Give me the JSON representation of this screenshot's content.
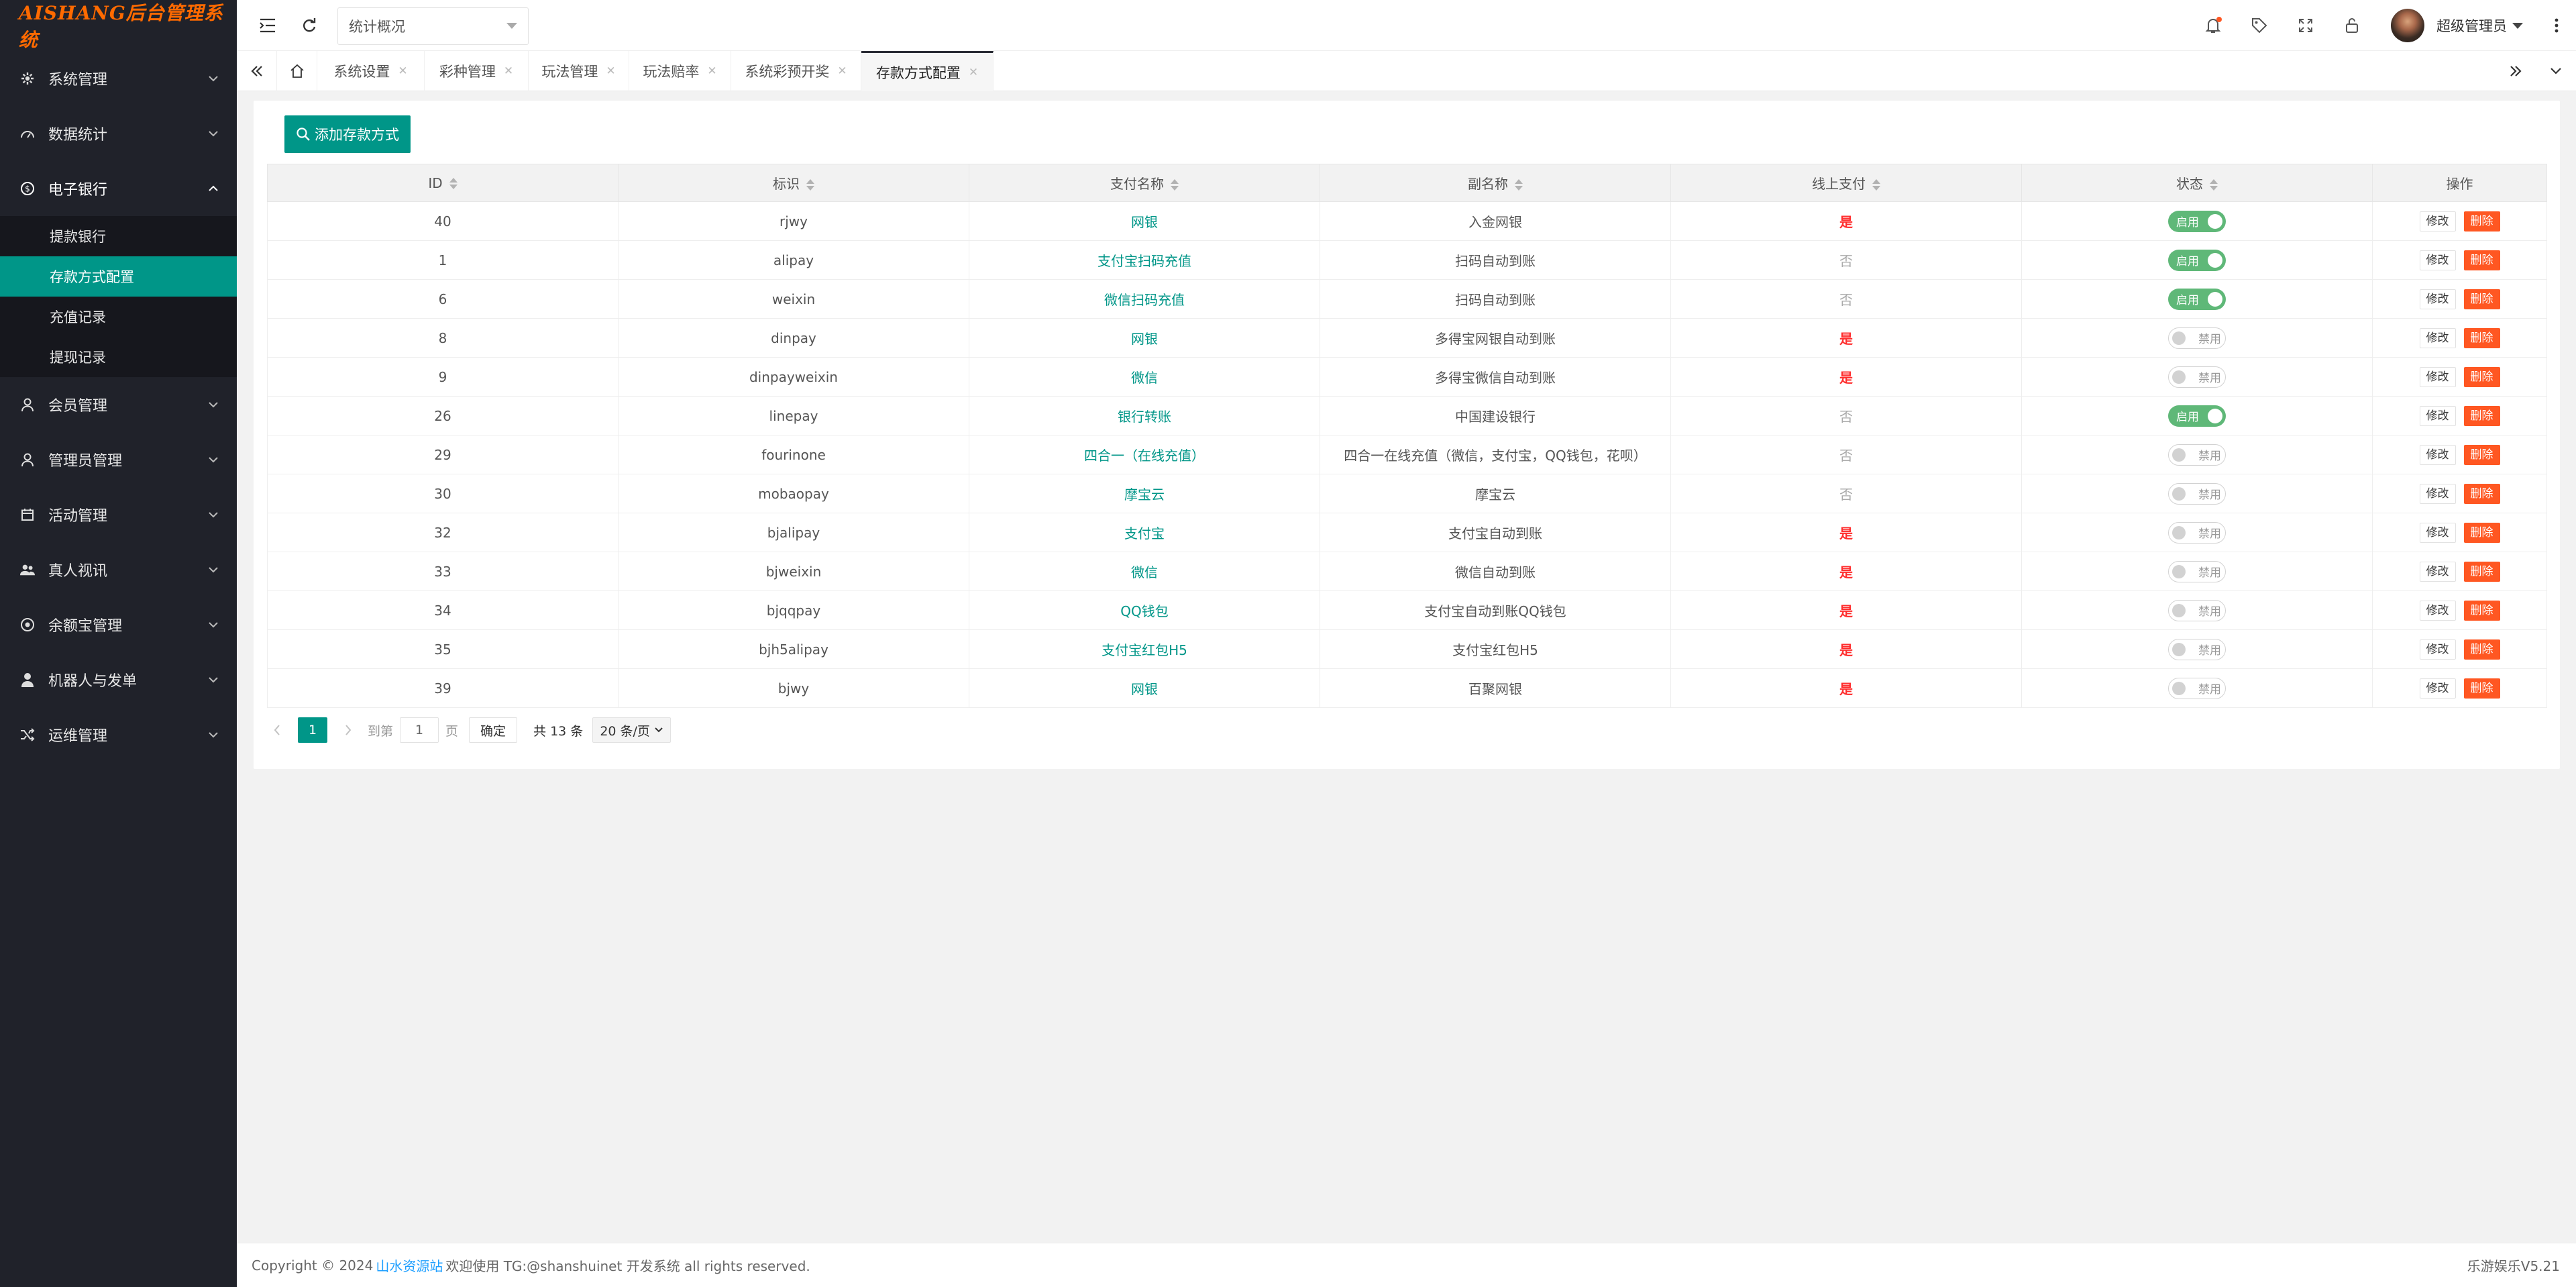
{
  "app": {
    "logo": "AISHANG后台管理系统"
  },
  "sidebar": {
    "groups": [
      {
        "label": "系统管理",
        "icon": "gear-icon",
        "expanded": false
      },
      {
        "label": "数据统计",
        "icon": "gauge-icon",
        "expanded": false
      },
      {
        "label": "电子银行",
        "icon": "dollar-icon",
        "expanded": true,
        "items": [
          {
            "label": "提款银行",
            "active": false
          },
          {
            "label": "存款方式配置",
            "active": true
          },
          {
            "label": "充值记录",
            "active": false
          },
          {
            "label": "提现记录",
            "active": false
          }
        ]
      },
      {
        "label": "会员管理",
        "icon": "user-icon",
        "expanded": false
      },
      {
        "label": "管理员管理",
        "icon": "user-icon",
        "expanded": false
      },
      {
        "label": "活动管理",
        "icon": "calendar-icon",
        "expanded": false
      },
      {
        "label": "真人视讯",
        "icon": "users-icon",
        "expanded": false
      },
      {
        "label": "余额宝管理",
        "icon": "circle-dollar-icon",
        "expanded": false
      },
      {
        "label": "机器人与发单",
        "icon": "person-icon",
        "expanded": false
      },
      {
        "label": "运维管理",
        "icon": "shuffle-icon",
        "expanded": false
      }
    ]
  },
  "header": {
    "select_value": "统计概况",
    "user_name": "超级管理员"
  },
  "tabs": [
    {
      "label": "系统设置"
    },
    {
      "label": "彩种管理"
    },
    {
      "label": "玩法管理"
    },
    {
      "label": "玩法赔率"
    },
    {
      "label": "系统彩预开奖"
    },
    {
      "label": "存款方式配置",
      "active": true
    }
  ],
  "toolbar": {
    "add_label": "添加存款方式"
  },
  "table": {
    "headers": [
      "ID",
      "标识",
      "支付名称",
      "副名称",
      "线上支付",
      "状态",
      "操作"
    ],
    "rows": [
      {
        "id": "40",
        "code": "rjwy",
        "name": "网银",
        "subname": "入金网银",
        "online": "是",
        "status": "启用"
      },
      {
        "id": "1",
        "code": "alipay",
        "name": "支付宝扫码充值",
        "subname": "扫码自动到账",
        "online": "否",
        "status": "启用"
      },
      {
        "id": "6",
        "code": "weixin",
        "name": "微信扫码充值",
        "subname": "扫码自动到账",
        "online": "否",
        "status": "启用"
      },
      {
        "id": "8",
        "code": "dinpay",
        "name": "网银",
        "subname": "多得宝网银自动到账",
        "online": "是",
        "status": "禁用"
      },
      {
        "id": "9",
        "code": "dinpayweixin",
        "name": "微信",
        "subname": "多得宝微信自动到账",
        "online": "是",
        "status": "禁用"
      },
      {
        "id": "26",
        "code": "linepay",
        "name": "银行转账",
        "subname": "中国建设银行",
        "online": "否",
        "status": "启用"
      },
      {
        "id": "29",
        "code": "fourinone",
        "name": "四合一（在线充值）",
        "subname": "四合一在线充值（微信，支付宝，QQ钱包，花呗）",
        "online": "否",
        "status": "禁用"
      },
      {
        "id": "30",
        "code": "mobaopay",
        "name": "摩宝云",
        "subname": "摩宝云",
        "online": "否",
        "status": "禁用"
      },
      {
        "id": "32",
        "code": "bjalipay",
        "name": "支付宝",
        "subname": "支付宝自动到账",
        "online": "是",
        "status": "禁用"
      },
      {
        "id": "33",
        "code": "bjweixin",
        "name": "微信",
        "subname": "微信自动到账",
        "online": "是",
        "status": "禁用"
      },
      {
        "id": "34",
        "code": "bjqqpay",
        "name": "QQ钱包",
        "subname": "支付宝自动到账QQ钱包",
        "online": "是",
        "status": "禁用"
      },
      {
        "id": "35",
        "code": "bjh5alipay",
        "name": "支付宝红包H5",
        "subname": "支付宝红包H5",
        "online": "是",
        "status": "禁用"
      },
      {
        "id": "39",
        "code": "bjwy",
        "name": "网银",
        "subname": "百聚网银",
        "online": "是",
        "status": "禁用"
      }
    ],
    "edit_label": "修改",
    "delete_label": "删除"
  },
  "pagination": {
    "current_page": "1",
    "goto_label": "到第",
    "page_input": "1",
    "page_unit": "页",
    "confirm_label": "确定",
    "total": "共 13 条",
    "per_page": "20 条/页"
  },
  "footer": {
    "copyright": "Copyright © 2024",
    "site_link": "山水资源站",
    "notice": "欢迎使用 TG:@shanshuinet 开发系统 all rights reserved.",
    "version": "乐游娱乐V5.21"
  },
  "colors": {
    "accent": "#009688",
    "danger": "#ff5722",
    "sidebar": "#20222a",
    "switch_on": "#5fb878",
    "logo": "#ff6a00"
  }
}
